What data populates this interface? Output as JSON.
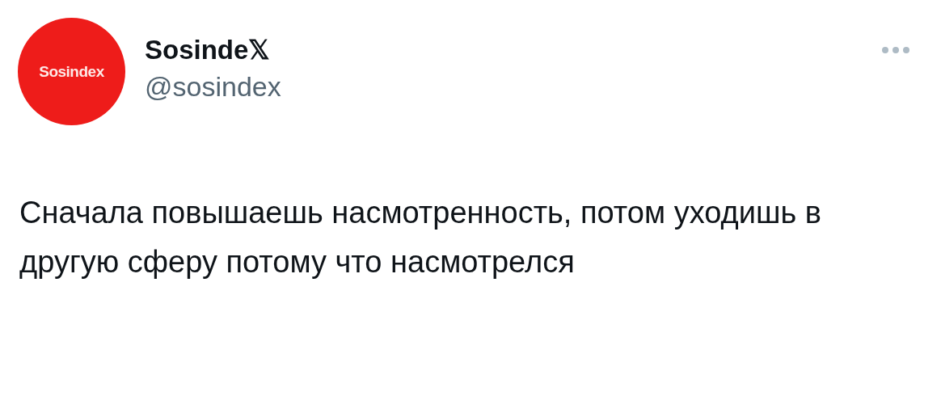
{
  "author": {
    "avatar_text": "Sosindex",
    "display_name": "Sosinde𝕏",
    "handle": "@sosindex"
  },
  "tweet": {
    "text": "Сначала повышаешь насмотренность, потом уходишь в другую сферу потому что насмотрелся"
  }
}
